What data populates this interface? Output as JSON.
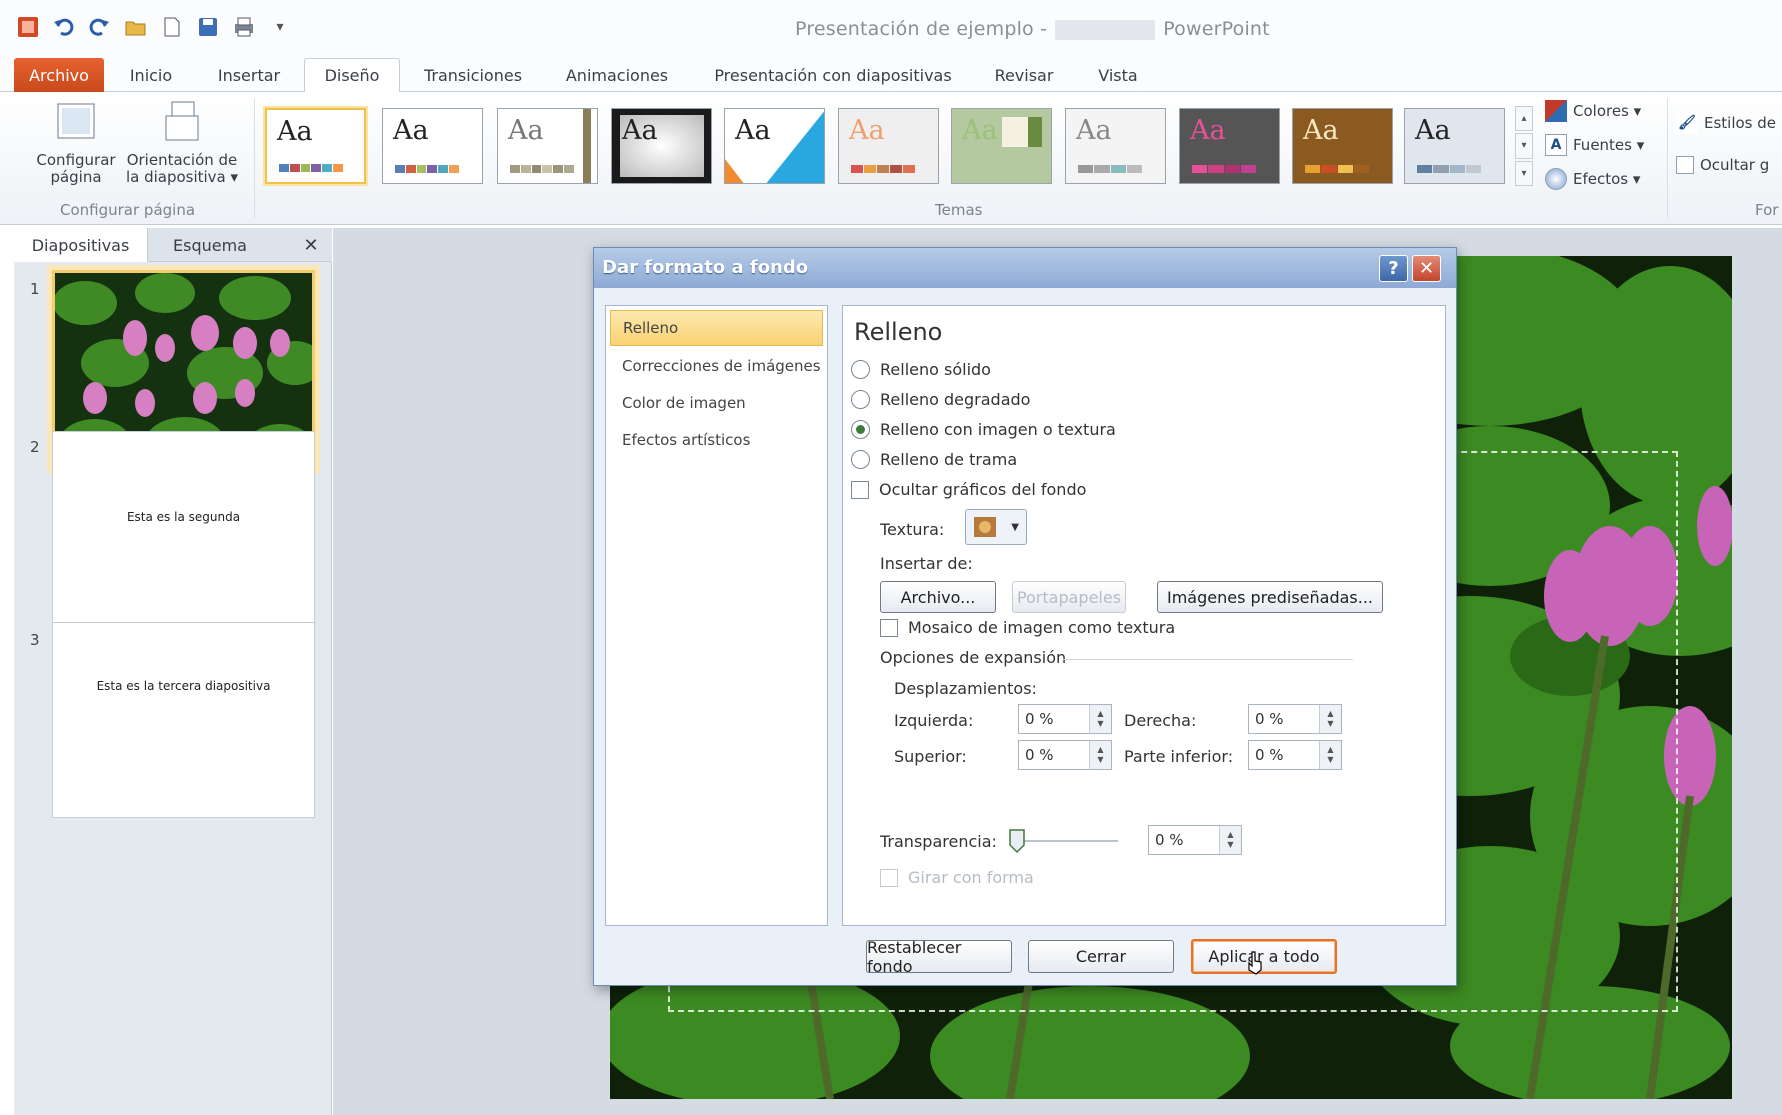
{
  "window": {
    "title_left": "Presentación de ejemplo -",
    "title_right": "PowerPoint"
  },
  "tabs": [
    {
      "label": "Archivo"
    },
    {
      "label": "Inicio"
    },
    {
      "label": "Insertar"
    },
    {
      "label": "Diseño"
    },
    {
      "label": "Transiciones"
    },
    {
      "label": "Animaciones"
    },
    {
      "label": "Presentación con diapositivas"
    },
    {
      "label": "Revisar"
    },
    {
      "label": "Vista"
    }
  ],
  "ribbon": {
    "configurar_pagina": {
      "line1": "Configurar",
      "line2": "página"
    },
    "orientacion": {
      "line1": "Orientación de",
      "line2": "la diapositiva ▾"
    },
    "group_configurar": "Configurar página",
    "group_temas": "Temas",
    "theme_sample": "Aa",
    "colores": "Colores ▾",
    "fuentes": "Fuentes ▾",
    "efectos": "Efectos ▾",
    "estilos": "Estilos de",
    "ocultar": "Ocultar g",
    "group_fondo": "For"
  },
  "panel": {
    "tab_diapositivas": "Diapositivas",
    "tab_esquema": "Esquema",
    "close": "✕",
    "slides": [
      {
        "number": "1",
        "text": ""
      },
      {
        "number": "2",
        "text": "Esta es la segunda"
      },
      {
        "number": "3",
        "text": "Esta es la tercera diapositiva"
      }
    ]
  },
  "dialog": {
    "title": "Dar formato a fondo",
    "help": "?",
    "close": "✕",
    "nav": [
      "Relleno",
      "Correcciones de imágenes",
      "Color de imagen",
      "Efectos artísticos"
    ],
    "heading": "Relleno",
    "options": {
      "solido": "Relleno sólido",
      "degradado": "Relleno degradado",
      "imagen": "Relleno con imagen o textura",
      "trama": "Relleno de trama",
      "ocultar": "Ocultar gráficos del fondo"
    },
    "textura_label": "Textura:",
    "insertar_de": "Insertar de:",
    "btn_archivo": "Archivo...",
    "btn_portapapeles": "Portapapeles",
    "btn_imagenes": "Imágenes prediseñadas...",
    "mosaico": "Mosaico de imagen como textura",
    "opciones_expansion": "Opciones de expansión",
    "desplazamientos": "Desplazamientos:",
    "izquierda": "Izquierda:",
    "derecha": "Derecha:",
    "superior": "Superior:",
    "inferior": "Parte inferior:",
    "offset_izquierda": "0 %",
    "offset_derecha": "0 %",
    "offset_superior": "0 %",
    "offset_inferior": "0 %",
    "transparencia": "Transparencia:",
    "transparencia_value": "0 %",
    "girar": "Girar con forma",
    "btn_restablecer": "Restablecer fondo",
    "btn_cerrar": "Cerrar",
    "btn_aplicar": "Aplicar a todo"
  },
  "colors": {
    "accent_file": "#d9562a",
    "dialog_title": "#8ea9d4",
    "selection": "#f9d271"
  }
}
